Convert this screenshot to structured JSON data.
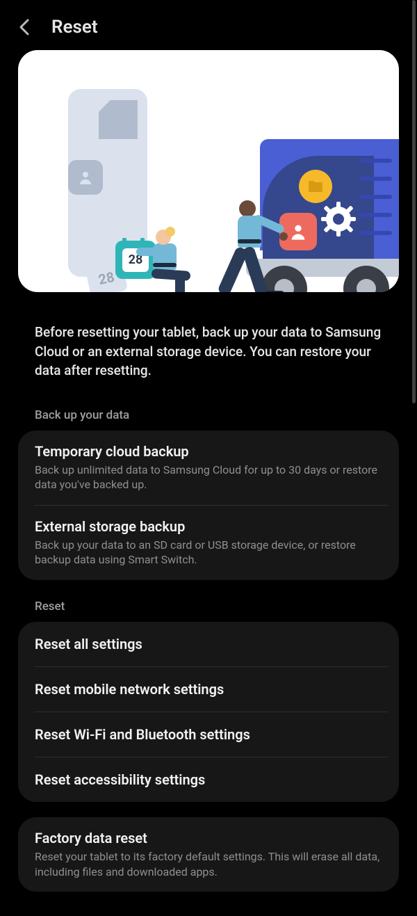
{
  "header": {
    "title": "Reset"
  },
  "intro": "Before resetting your tablet, back up your data to Samsung Cloud or an external storage device. You can restore your data after resetting.",
  "illustration": {
    "calendar_number": "28",
    "ticket_number": "28"
  },
  "sections": {
    "backup": {
      "label": "Back up your data",
      "items": [
        {
          "title": "Temporary cloud backup",
          "desc": "Back up unlimited data to Samsung Cloud for up to 30 days or restore data you've backed up."
        },
        {
          "title": "External storage backup",
          "desc": "Back up your data to an SD card or USB storage device, or restore backup data using Smart Switch."
        }
      ]
    },
    "reset": {
      "label": "Reset",
      "items": [
        {
          "title": "Reset all settings"
        },
        {
          "title": "Reset mobile network settings"
        },
        {
          "title": "Reset Wi-Fi and Bluetooth settings"
        },
        {
          "title": "Reset accessibility settings"
        }
      ]
    },
    "factory": {
      "title": "Factory data reset",
      "desc": "Reset your tablet to its factory default settings. This will erase all data, including files and downloaded apps."
    }
  }
}
